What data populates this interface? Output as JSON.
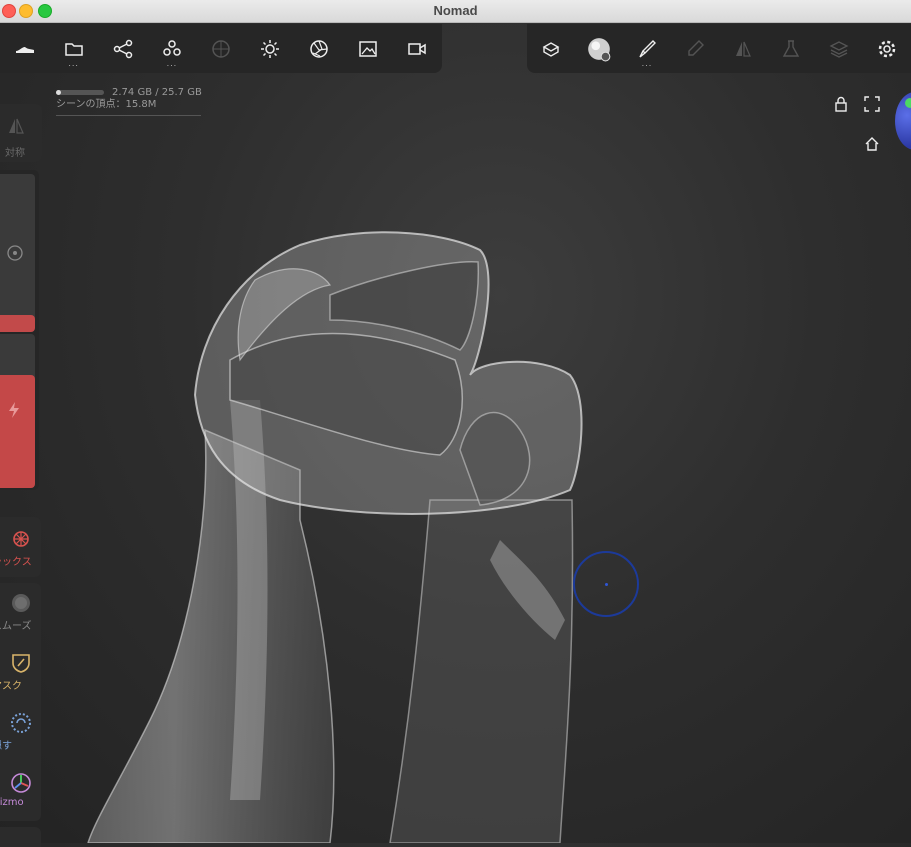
{
  "window": {
    "title": "Nomad"
  },
  "toolbar_left": [
    {
      "icon": "shoe-icon",
      "more": false
    },
    {
      "icon": "folder-icon",
      "more": true
    },
    {
      "icon": "share-icon",
      "more": false
    },
    {
      "icon": "primitives-icon",
      "more": true
    },
    {
      "icon": "sphere-grid-icon",
      "more": false
    },
    {
      "icon": "sun-icon",
      "more": false
    },
    {
      "icon": "aperture-icon",
      "more": false
    },
    {
      "icon": "image-icon",
      "more": false
    },
    {
      "icon": "camera-icon",
      "more": false
    }
  ],
  "toolbar_right": [
    {
      "icon": "layers-box-icon",
      "more": false
    },
    {
      "icon": "matcap-icon",
      "more": false
    },
    {
      "icon": "paint-brush-icon",
      "more": true
    },
    {
      "icon": "eyedropper-icon",
      "more": false
    },
    {
      "icon": "symmetry-icon",
      "more": false
    },
    {
      "icon": "flask-icon",
      "more": false
    },
    {
      "icon": "stack-icon",
      "more": false
    },
    {
      "icon": "gear-icon",
      "more": false
    }
  ],
  "more_indicator": "...",
  "stats": {
    "memory": "2.74 GB / 25.7 GB",
    "memory_fraction": 0.107,
    "vertices": "シーンの頂点：15.8M"
  },
  "left_panel": {
    "symmetry_label": "対称",
    "tools": [
      {
        "label": "ラックス",
        "icon": "relax-icon",
        "color": "#d9534f"
      },
      {
        "label": "スムーズ",
        "icon": "smooth-icon",
        "color": "#8a8a8a"
      },
      {
        "label": "マスク",
        "icon": "mask-icon",
        "color": "#d9b46a"
      },
      {
        "label": "隠す",
        "icon": "hide-icon",
        "color": "#7aa2d8"
      },
      {
        "label": "Gizmo",
        "icon": "gizmo-icon",
        "color": "#c58ad8"
      }
    ]
  },
  "colors": {
    "accent_red": "#c44848",
    "cursor_blue": "#1c3a9a"
  }
}
